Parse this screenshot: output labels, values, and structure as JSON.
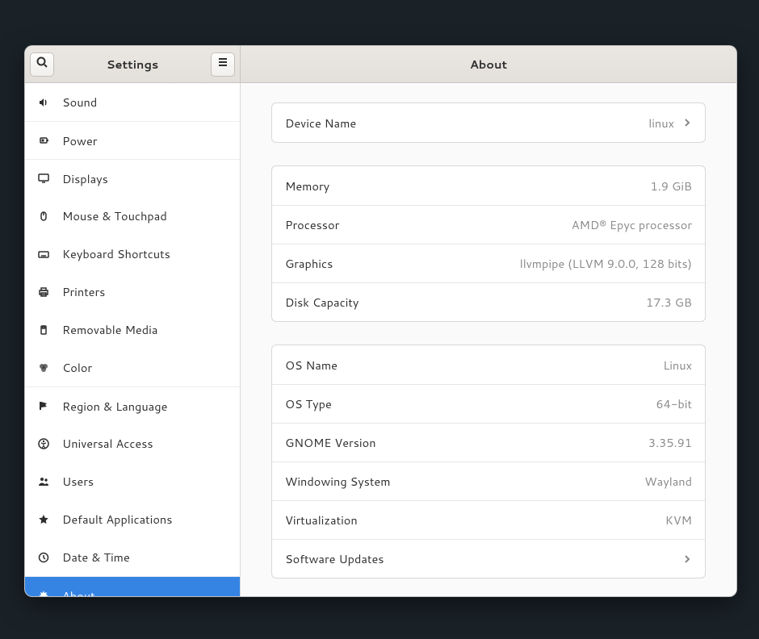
{
  "header": {
    "sidebar_title": "Settings",
    "content_title": "About"
  },
  "sidebar": {
    "items": [
      {
        "id": "sound",
        "label": "Sound"
      },
      {
        "id": "power",
        "label": "Power"
      },
      {
        "id": "displays",
        "label": "Displays"
      },
      {
        "id": "mouse",
        "label": "Mouse & Touchpad"
      },
      {
        "id": "keyboard",
        "label": "Keyboard Shortcuts"
      },
      {
        "id": "printers",
        "label": "Printers"
      },
      {
        "id": "removable",
        "label": "Removable Media"
      },
      {
        "id": "color",
        "label": "Color"
      },
      {
        "id": "region",
        "label": "Region & Language"
      },
      {
        "id": "accessibility",
        "label": "Universal Access"
      },
      {
        "id": "users",
        "label": "Users"
      },
      {
        "id": "defaults",
        "label": "Default Applications"
      },
      {
        "id": "datetime",
        "label": "Date & Time"
      },
      {
        "id": "about",
        "label": "About"
      }
    ]
  },
  "about": {
    "device": {
      "device_name_label": "Device Name",
      "device_name_value": "linux"
    },
    "hw": {
      "memory_label": "Memory",
      "memory_value": "1.9 GiB",
      "processor_label": "Processor",
      "processor_value": "AMD® Epyc processor",
      "graphics_label": "Graphics",
      "graphics_value": "llvmpipe (LLVM 9.0.0, 128 bits)",
      "disk_label": "Disk Capacity",
      "disk_value": "17.3 GB"
    },
    "os": {
      "os_name_label": "OS Name",
      "os_name_value": "Linux",
      "os_type_label": "OS Type",
      "os_type_value": "64-bit",
      "gnome_label": "GNOME Version",
      "gnome_value": "3.35.91",
      "windowing_label": "Windowing System",
      "windowing_value": "Wayland",
      "virt_label": "Virtualization",
      "virt_value": "KVM",
      "updates_label": "Software Updates"
    }
  }
}
